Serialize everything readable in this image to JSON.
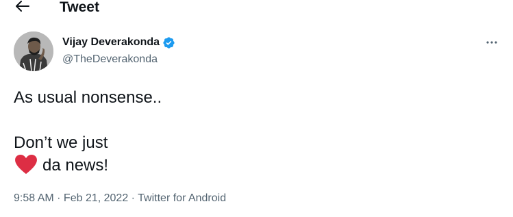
{
  "header": {
    "back_icon": "arrow-left-icon",
    "title": "Tweet"
  },
  "author": {
    "name": "Vijay Deverakonda",
    "handle": "@TheDeverakonda",
    "verified": true,
    "verified_color": "#1d9bf0"
  },
  "tweet": {
    "lines": [
      "As usual nonsense..",
      "",
      "Don’t we just",
      "da news!"
    ],
    "emoji": "red-heart-icon",
    "emoji_color": "#dd2e44"
  },
  "meta": {
    "time": "9:58 AM",
    "date": "Feb 21, 2022",
    "source": "Twitter for Android",
    "separator": " · "
  },
  "more_icon": "more-horizontal-icon"
}
